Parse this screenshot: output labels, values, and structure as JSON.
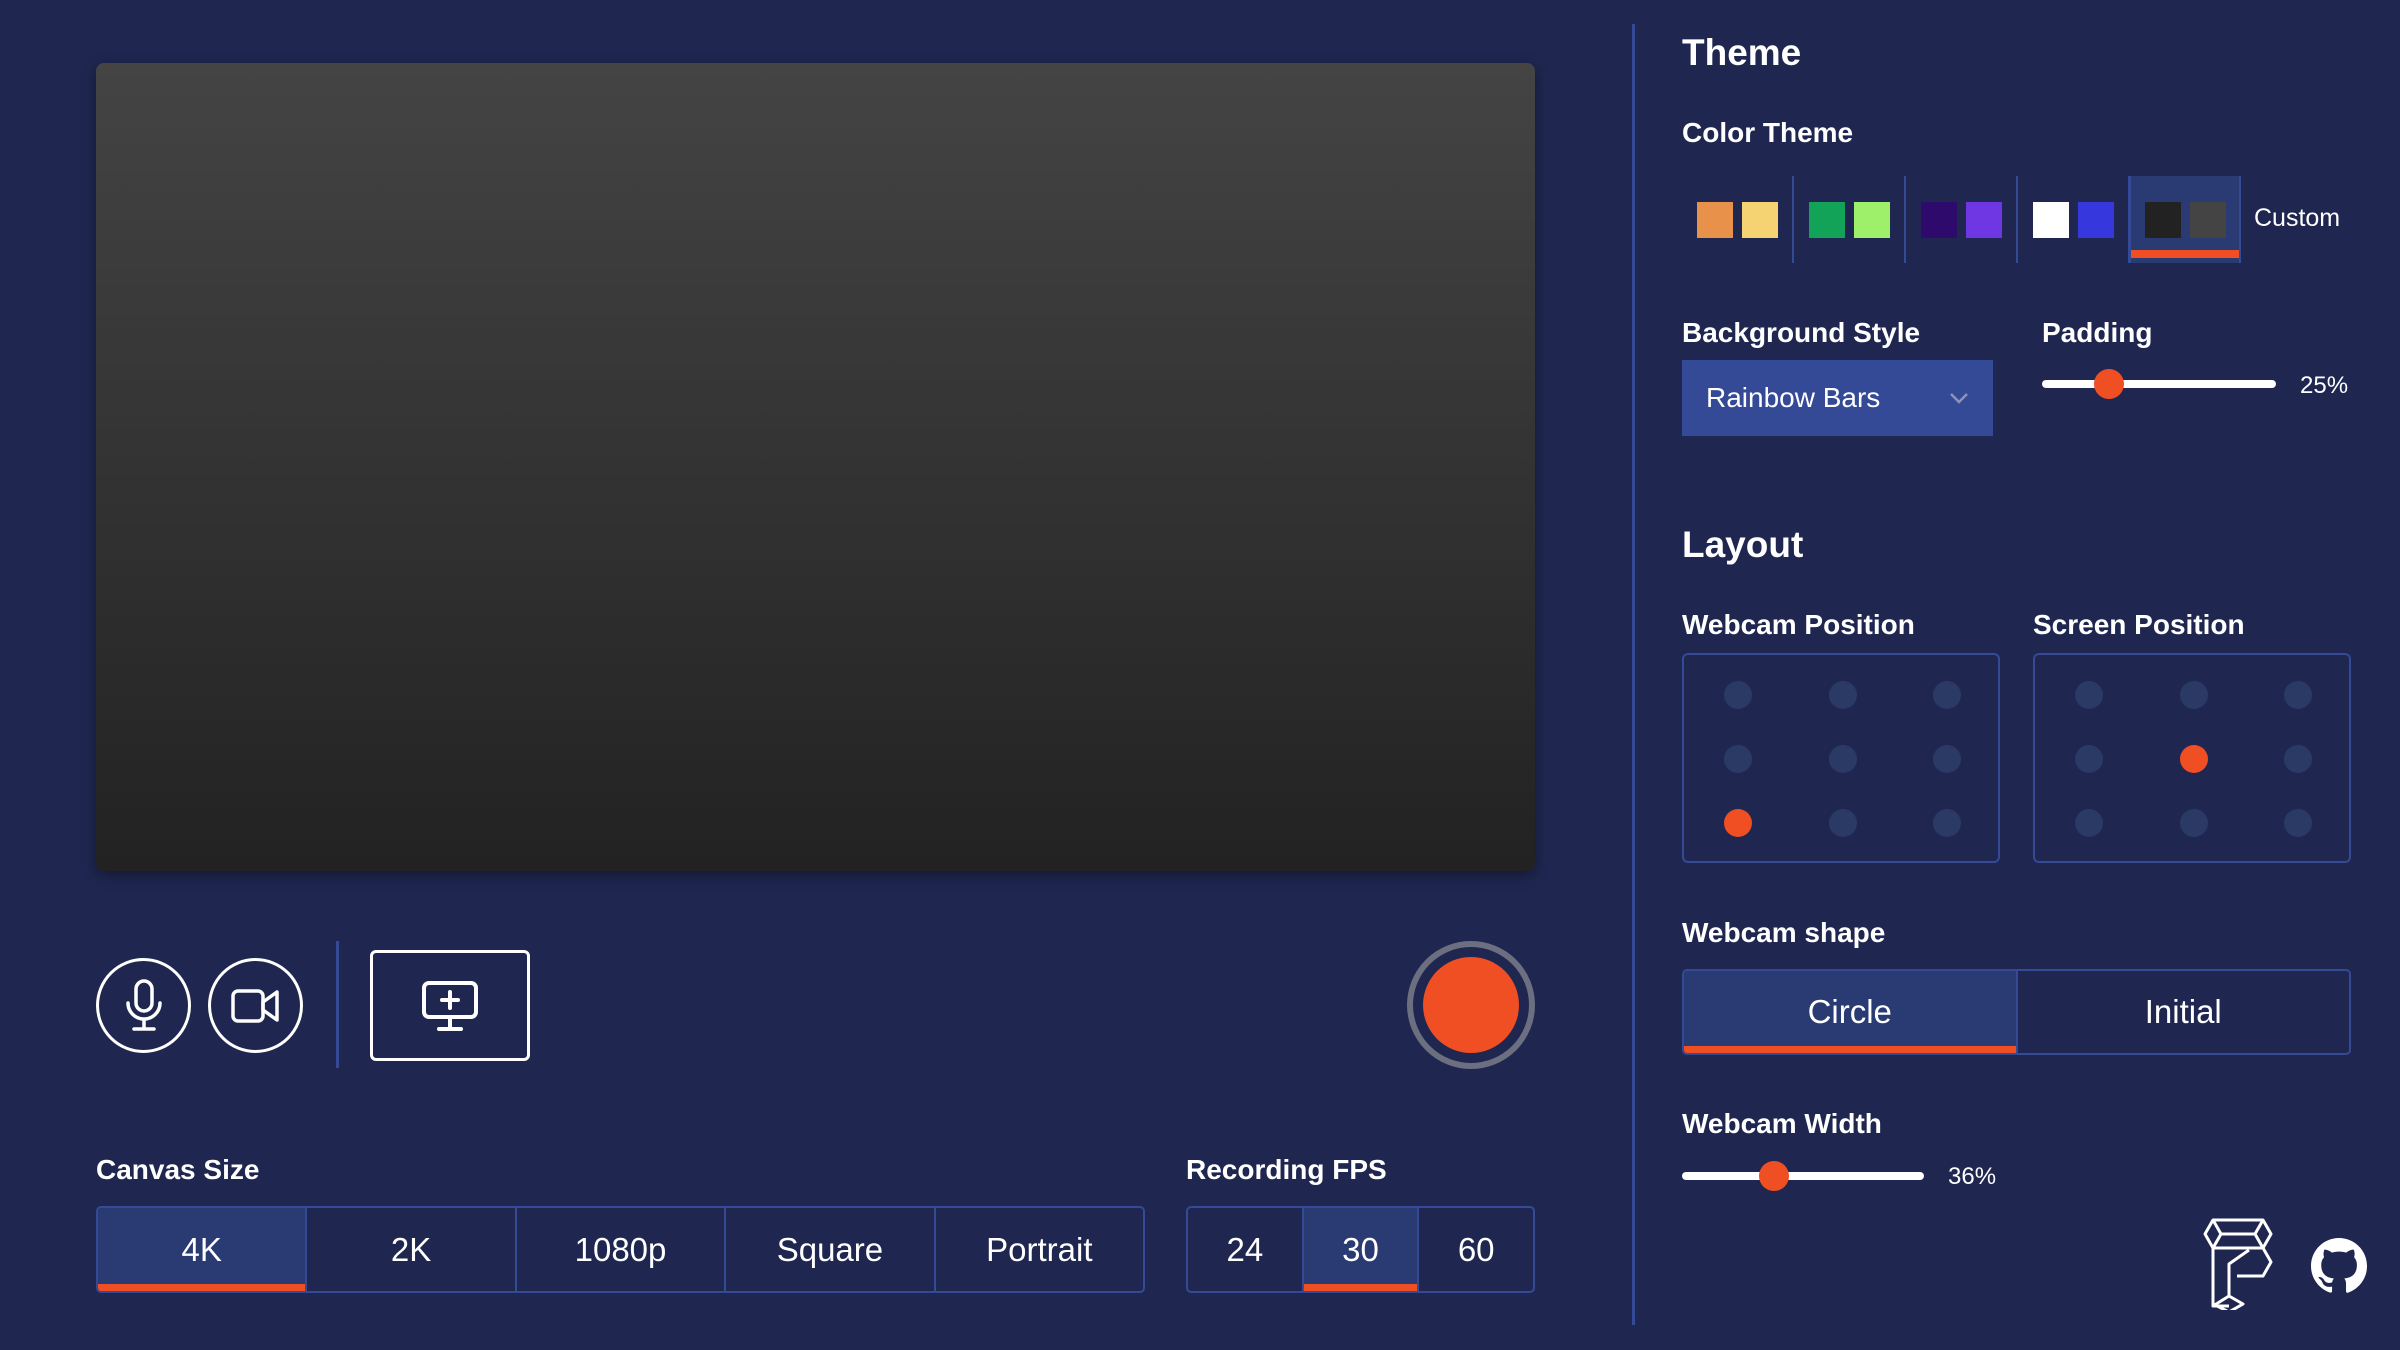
{
  "preview": {},
  "controls": {
    "mic": "microphone-icon",
    "camera": "video-camera-icon",
    "screen": "add-screen-icon",
    "record": "record-button"
  },
  "canvas_size": {
    "label": "Canvas Size",
    "options": [
      "4K",
      "2K",
      "1080p",
      "Square",
      "Portrait"
    ],
    "selected": "4K"
  },
  "fps": {
    "label": "Recording FPS",
    "options": [
      "24",
      "30",
      "60"
    ],
    "selected": "30"
  },
  "theme": {
    "title": "Theme",
    "color_theme_label": "Color Theme",
    "swatches": [
      [
        "#e8914a",
        "#f5d373"
      ],
      [
        "#13a358",
        "#9ef06a"
      ],
      [
        "#2d0a6b",
        "#6f37e3"
      ],
      [
        "#ffffff",
        "#3737de"
      ],
      [
        "#222222",
        "#444444"
      ]
    ],
    "selected_index": 4,
    "custom_label": "Custom",
    "background_style_label": "Background Style",
    "background_style_value": "Rainbow Bars",
    "padding_label": "Padding",
    "padding_value": "25%",
    "padding_fraction": 0.25
  },
  "layout": {
    "title": "Layout",
    "webcam_position_label": "Webcam Position",
    "webcam_position_selected": [
      2,
      0
    ],
    "screen_position_label": "Screen Position",
    "screen_position_selected": [
      1,
      1
    ],
    "webcam_shape_label": "Webcam shape",
    "webcam_shape_options": [
      "Circle",
      "Initial"
    ],
    "webcam_shape_selected": "Circle",
    "webcam_width_label": "Webcam Width",
    "webcam_width_value": "36%",
    "webcam_width_fraction": 0.36
  },
  "colors": {
    "background": "#1f2751",
    "accent": "#f04e23",
    "border": "#344a96"
  }
}
